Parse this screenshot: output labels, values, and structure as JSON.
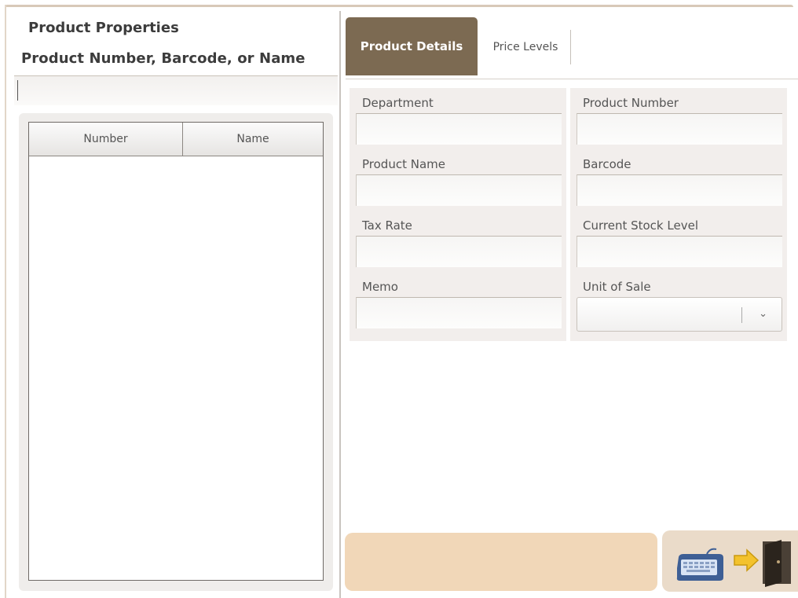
{
  "left_panel": {
    "title": "Product Properties",
    "search_label": "Product Number, Barcode, or Name",
    "search_value": "",
    "columns": [
      "Number",
      "Name"
    ],
    "rows": []
  },
  "tabs": [
    {
      "label": "Product Details",
      "active": true
    },
    {
      "label": "Price Levels",
      "active": false
    }
  ],
  "fields": {
    "department": {
      "label": "Department",
      "value": ""
    },
    "product_number": {
      "label": "Product Number",
      "value": ""
    },
    "product_name": {
      "label": "Product Name",
      "value": ""
    },
    "barcode": {
      "label": "Barcode",
      "value": ""
    },
    "tax_rate": {
      "label": "Tax Rate",
      "value": ""
    },
    "current_stock_level": {
      "label": "Current Stock Level",
      "value": ""
    },
    "memo": {
      "label": "Memo",
      "value": ""
    },
    "unit_of_sale": {
      "label": "Unit of Sale",
      "value": ""
    }
  },
  "status_message": "",
  "icons": {
    "exit": "keyboard-arrow-door-icon",
    "dropdown": "chevron-down-icon"
  },
  "colors": {
    "active_tab": "#7c6a52",
    "status_bar": "#f1d7b8",
    "exit_button": "#eadbc9"
  }
}
